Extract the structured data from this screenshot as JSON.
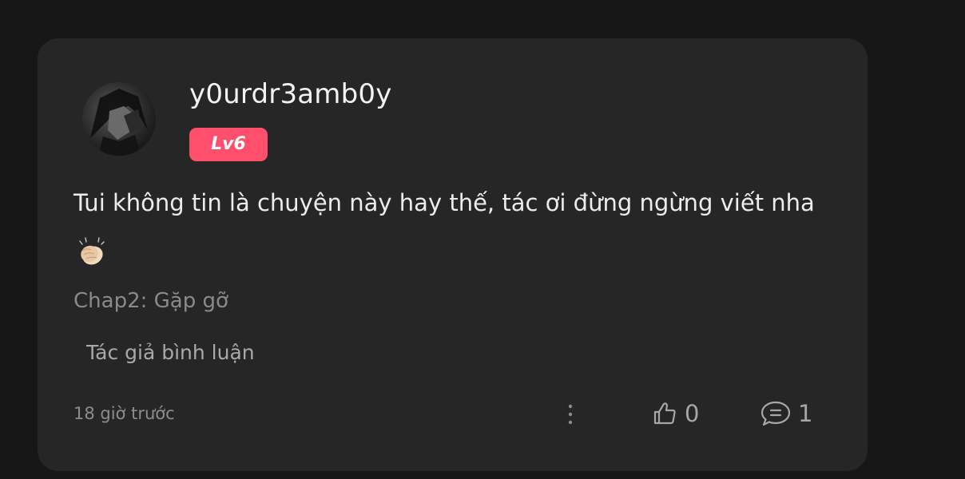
{
  "comment": {
    "username": "y0urdr3amb0y",
    "level_badge": "Lv6",
    "text": "Tui không tin là chuyện này hay thế, tác ơi đừng ngừng viết nha",
    "emoji_icon": "clapping-hands-icon",
    "chapter": "Chap2: Gặp gỡ",
    "author_reply_link": "Tác giả bình luận",
    "timestamp": "18 giờ trước",
    "like_count": "0",
    "reply_count": "1"
  },
  "colors": {
    "background": "#171717",
    "card": "#262626",
    "badge": "#ff4f6d",
    "primary_text": "#ececec",
    "muted_text": "#8a8a8a"
  }
}
